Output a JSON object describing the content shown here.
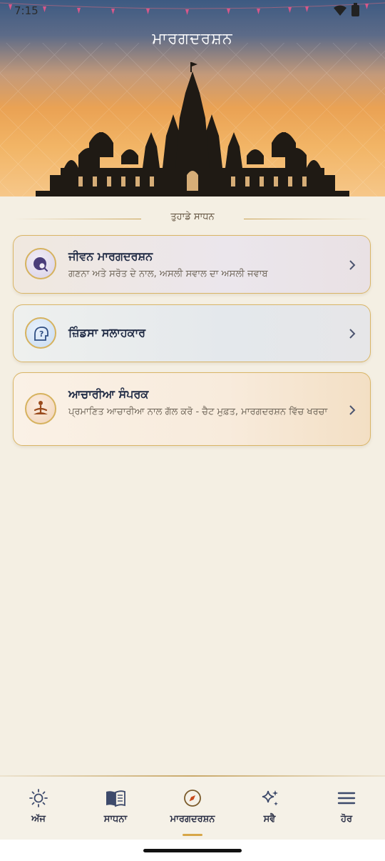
{
  "status_bar": {
    "time": "7:15"
  },
  "header": {
    "title": "ਮਾਰਗਦਰਸ਼ਨ"
  },
  "section": {
    "label": "ਤੁਹਾਡੇ ਸਾਧਨ"
  },
  "cards": [
    {
      "title": "ਜੀਵਨ ਮਾਰਗਦਰਸ਼ਨ",
      "subtitle": "ਗਣਨਾ ਅਤੇ ਸਰੋਤ ਦੇ ਨਾਲ, ਅਸਲੀ ਸਵਾਲ ਦਾ ਅਸਲੀ ਜਵਾਬ",
      "icon": "globe-search-icon"
    },
    {
      "title": "ਜ਼ਿੰਡਸਾ ਸਲਾਹਕਾਰ",
      "subtitle": "",
      "icon": "head-question-icon"
    },
    {
      "title": "ਆਚਾਰੀਆ ਸੰਪਰਕ",
      "subtitle": "ਪ੍ਰਮਾਣਿਤ ਆਚਾਰੀਆ ਨਾਲ ਗੱਲ ਕਰੋ - ਚੈਟ ਮੁਫ਼ਤ, ਮਾਰਗਦਰਸ਼ਨ ਵਿੱਚ ਖਰਚਾ",
      "icon": "meditation-icon"
    }
  ],
  "nav": {
    "items": [
      {
        "label": "ਅੱਜ",
        "icon": "sun-icon"
      },
      {
        "label": "ਸਾਧਨਾ",
        "icon": "book-icon"
      },
      {
        "label": "ਮਾਰਗਦਰਸ਼ਨ",
        "icon": "compass-icon"
      },
      {
        "label": "ਸਵੈ",
        "icon": "sparkle-icon"
      },
      {
        "label": "ਹੋਰ",
        "icon": "menu-icon"
      }
    ],
    "active": "ਮਾਰਗਦਰਸ਼ਨ"
  },
  "colors": {
    "accent": "#d9b566",
    "background": "#f4efe3",
    "text": "#1f2a44"
  }
}
